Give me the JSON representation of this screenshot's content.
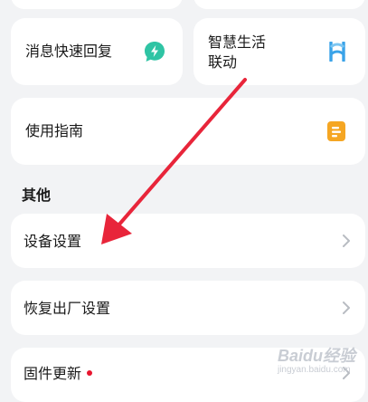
{
  "cards": {
    "quick_reply": {
      "label": "消息快速回复",
      "icon": "lightning-bubble-icon",
      "icon_color": "#2fc4a4"
    },
    "smart_life": {
      "label_line1": "智慧生活",
      "label_line2": "联动",
      "icon": "smart-link-icon",
      "icon_color": "#3aa3e8"
    },
    "guide": {
      "label": "使用指南",
      "icon": "guide-book-icon",
      "icon_color": "#f5a623"
    }
  },
  "others": {
    "section_title": "其他",
    "items": [
      {
        "label": "设备设置"
      },
      {
        "label": "恢复出厂设置"
      },
      {
        "label": "固件更新",
        "has_dot": true
      }
    ]
  },
  "watermark": {
    "line1": "Baidu经验",
    "line2": "jingyan.baidu.com"
  },
  "colors": {
    "background": "#f2f3f5",
    "card": "#ffffff",
    "annotation_arrow": "#e8253a",
    "badge_dot": "#e8152e",
    "chevron": "#b8bcc2"
  }
}
